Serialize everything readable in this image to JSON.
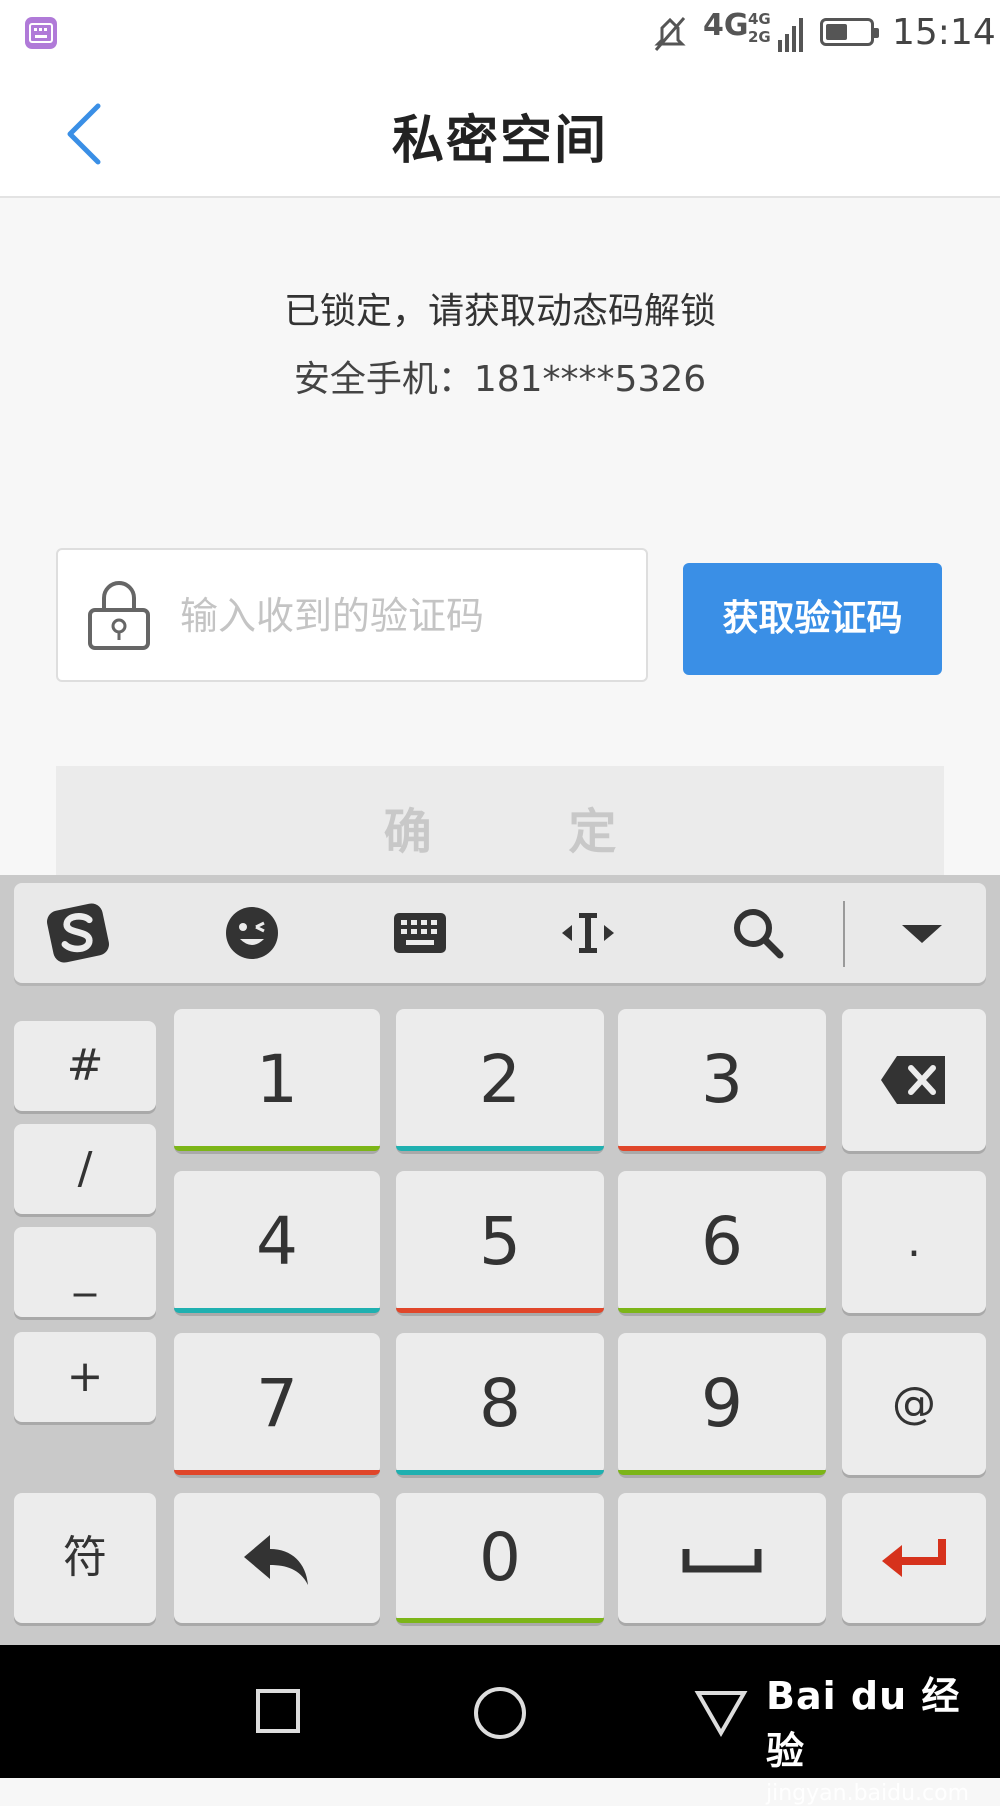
{
  "status_bar": {
    "network_4g": "4G",
    "network_4g_small": "4G",
    "network_2g_small": "2G",
    "time": "15:14",
    "battery_level": 0.5
  },
  "header": {
    "title": "私密空间"
  },
  "lock_info": {
    "message": "已锁定，请获取动态码解锁",
    "phone": "安全手机：181****5326"
  },
  "code_field": {
    "placeholder": "输入收到的验证码",
    "value": ""
  },
  "get_code_button": "获取验证码",
  "confirm_button": "确 定",
  "keyboard": {
    "toolbar_icons": [
      "sogou-logo-icon",
      "emoji-icon",
      "keyboard-icon",
      "cursor-icon",
      "search-icon",
      "collapse-icon"
    ],
    "symbols": [
      "#",
      "/",
      "_",
      "+"
    ],
    "digits": [
      "1",
      "2",
      "3",
      "4",
      "5",
      "6",
      "7",
      "8",
      "9",
      "0"
    ],
    "dot": ".",
    "at": "@",
    "fu": "符",
    "underline_colors": {
      "green": "#7cb518",
      "teal": "#1fb0b0",
      "red": "#e0462a"
    },
    "enter_color": "#d6321c"
  },
  "watermark": {
    "logo": "Bai du 经验",
    "url": "jingyan.baidu.com"
  }
}
